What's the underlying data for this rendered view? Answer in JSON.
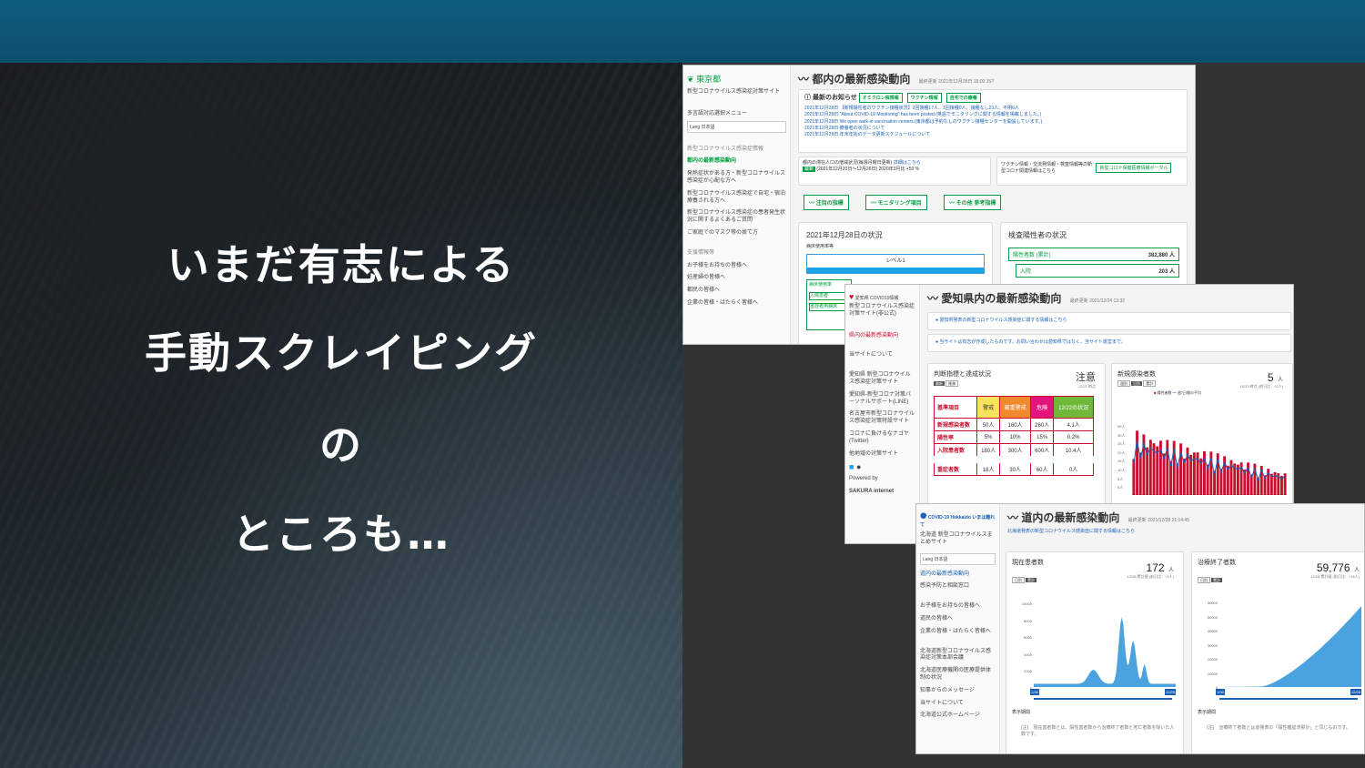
{
  "slide": {
    "lines": [
      "いまだ有志による",
      "手動スクレイピング",
      "の",
      "ところも…"
    ]
  },
  "colors": {
    "topbar": "#0a4f6c",
    "accent_green": "#00a040",
    "accent_red": "#c8102e",
    "chart_blue": "#4aa3df"
  },
  "tokyo": {
    "logo": "東京都",
    "site_sub": "新型コロナウイルス感染症対策サイト",
    "menu_label": "多言語対応選択メニュー",
    "lang": "Lang 日本語",
    "section": "新型コロナウイルス感染症情報",
    "side_items": [
      "都内の最新感染動向",
      "発熱症状がある方・新型コロナウイルス感染症が心配な方へ",
      "新型コロナウイルス感染症で自宅・宿泊療養される方へ",
      "新型コロナウイルス感染症の患者発生状況に関するよくあるご質問",
      "ご家庭でのマスク等の捨て方"
    ],
    "section2": "支援情報等",
    "side_items2": [
      "お子様をお持ちの皆様へ",
      "妊産婦の皆様へ",
      "都民の皆様へ",
      "企業の皆様・はたらく皆様へ"
    ],
    "title": "都内の最新感染動向",
    "updated": "最終更新 2021年12月28日 18:00 JST",
    "news_title": "最新のお知らせ",
    "news_buttons": [
      "オミクロン株情報",
      "ワクチン情報",
      "自宅での療養"
    ],
    "news": [
      "2021年12月28日 【新規陽性者のワクチン接種状況】2回接種17人、1回接種0人、接種なし23人、不明6人",
      "2021年12月28日 \"About COVID-19 Monitoring\" has been posted.(英語でモニタリングに関する情報を掲載しました。)",
      "2021年12月28日 We open walk-in vaccination centers.(東京都は予約なしのワクチン接種センターを開設しています。)",
      "2021年12月28日 療養者の状況について",
      "2021年12月28日 年末年始のデータ更新スケジュールについて"
    ],
    "pop_label": "都内の滞在人口の増減状況(毎週月曜日更新)",
    "pop_link": "詳細はこちら",
    "pop_badge": "最新",
    "pop_range": "(2021年12月20日～12月26日) 2020年3月比 +50 %",
    "vac_label": "ワクチン情報・交流発情報・検査情報等の新型コロナ関連情報はこちら",
    "vac_btn": "新型コロナ保健医療情報ポータル",
    "tabs": [
      "注目の指標",
      "モニタリング項目",
      "その他 参考指標"
    ],
    "status_title": "2021年12月28日の状況",
    "status_sub": "病床使用率等",
    "level": "レベル1",
    "test_title": "検査陽性者の状況",
    "test_rows": [
      {
        "label": "陽性者数 (累計)",
        "value": "382,880 人"
      },
      {
        "label": "入院",
        "value": "203 人"
      }
    ],
    "mini_labels": [
      "病床使用率",
      "入院患者",
      "重症者用病床"
    ]
  },
  "aichi": {
    "logo": "愛知県 COVID19情報",
    "site_sub": "新型コロナウイルス感染症対策サイト(非公式)",
    "side_items": [
      "県内の最新感染動向",
      "当サイトについて",
      "愛知県 新型コロナウイルス感染症対策サイト",
      "愛知県-新型コロナ対策パーソナルサポート(LINE)",
      "名古屋市新型コロナウイルス感染症対策特設サイト",
      "コロナに負けるなナゴヤ(Twitter)",
      "他地域の対策サイト"
    ],
    "powered": "Powered by",
    "sakura": "SAKURA internet",
    "title": "愛知県内の最新感染動向",
    "updated": "最終更新 2021/12/24 13:32",
    "notice1": "愛知県発表の新型コロナウイルス感染症に関する情報はこちら",
    "notice2": "当サイトは有志が作成したものです。お問い合わせは愛知県ではなく、当サイト運営まで。",
    "crit_title": "判断指標と達成状況",
    "crit_status": "注意",
    "crit_date": "12/22 時点",
    "crit_tabs": [
      "最新",
      "推移"
    ],
    "crit_head": [
      "基準項目",
      "警戒",
      "厳重警戒",
      "危険",
      "12/22の状況"
    ],
    "crit_rows": [
      [
        "新規感染者数",
        "50人",
        "160人",
        "260人",
        "4.1人"
      ],
      [
        "陽性率",
        "5%",
        "10%",
        "15%",
        "0.2%"
      ],
      [
        "入院患者数",
        "180人",
        "300人",
        "600人",
        "10.4人"
      ],
      [
        "重症者数",
        "18人",
        "30人",
        "60人",
        "0人"
      ]
    ],
    "new_title": "新規感染者数",
    "new_value": "5",
    "new_unit": "人",
    "new_date": "12/23 時点 (前日比：+2人)",
    "new_tabs": [
      "週別",
      "日別",
      "累計"
    ],
    "legend": [
      "陽性者数",
      "週7日間の平均"
    ],
    "yticks": [
      "35人",
      "30人",
      "25人",
      "20人",
      "15人",
      "10人",
      "5人",
      "0人"
    ]
  },
  "hokkaido": {
    "logo": "COVID-19 Hokkaido いまは離れて",
    "site_sub": "北海道 新型コロナウイルスまとめサイト",
    "lang": "Lang 日本語",
    "side_items": [
      "道内の最新感染動向",
      "感染予防と相談窓口",
      "お子様をお持ちの皆様へ",
      "道民の皆様へ",
      "企業の皆様・はたらく皆様へ",
      "北海道新型コロナウイルス感染症対策本部会議",
      "北海道医療機関の医療提供体制の状況",
      "知事からのメッセージ",
      "当サイトについて",
      "北海道公式ホームページ"
    ],
    "title": "道内の最新感染動向",
    "updated": "最終更新 2021/12/28 21:14:45",
    "notice": "北海道発表の新型コロナウイルス感染症に関する情報はこちら",
    "card1": {
      "title": "現在患者数",
      "value": "172",
      "unit": "人",
      "date": "12/28 累計値 (前日比：+4人)",
      "tabs": [
        "日別",
        "累計"
      ],
      "yticks": [
        "10000",
        "8000",
        "6000",
        "4000",
        "2000",
        "0"
      ]
    },
    "card2": {
      "title": "治療終了者数",
      "value": "59,776",
      "unit": "人",
      "date": "12/28 累計値 (前日比：+18人)",
      "tabs": [
        "日別",
        "累計"
      ],
      "yticks": [
        "60000",
        "50000",
        "40000",
        "30000",
        "20000",
        "10000",
        "0"
      ]
    },
    "period_label": "表示期間",
    "slider_start": "1/28",
    "slider_end": "12/28",
    "note1": "(注)　現在患者数とは、陽性患者数から治療終了者数と死亡者数を除いた人数です。",
    "note2": "(注)　治療終了者数とは道発表の「陽性確認済累計」と同じものです。"
  }
}
